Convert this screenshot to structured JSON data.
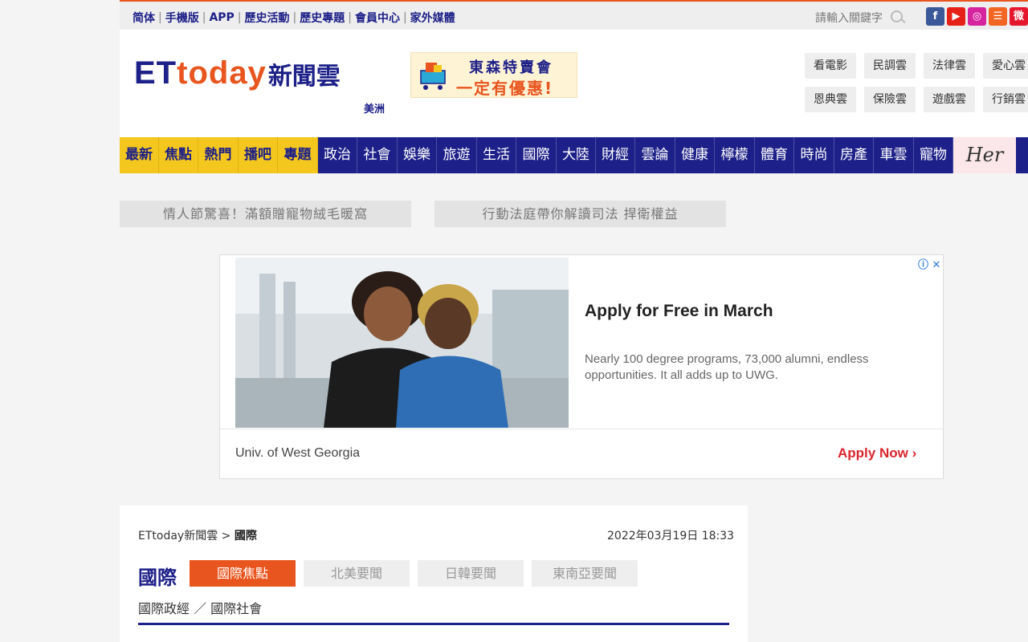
{
  "topbar": {
    "links": [
      "简体",
      "手機版",
      "APP",
      "歷史活動",
      "歷史專題",
      "會員中心",
      "家外媒體"
    ],
    "search_placeholder": "請輸入關鍵字",
    "social": [
      {
        "name": "facebook-icon",
        "glyph": "f",
        "color": "#3b5998"
      },
      {
        "name": "youtube-icon",
        "glyph": "▶",
        "color": "#e62117"
      },
      {
        "name": "instagram-icon",
        "glyph": "◎",
        "color": "#d6249f"
      },
      {
        "name": "rss-icon",
        "glyph": "☰",
        "color": "#f26522"
      },
      {
        "name": "weibo-icon",
        "glyph": "微",
        "color": "#e6162d"
      }
    ]
  },
  "header": {
    "logo_et": "ET",
    "logo_today": "today",
    "logo_cn": "新聞雲",
    "region": "美洲",
    "banner_line1": "東森特賣會",
    "banner_line2": "一定有優惠!",
    "cloud_links": [
      "看電影",
      "民調雲",
      "法律雲",
      "愛心雲",
      "恩典雲",
      "保險雲",
      "遊戲雲",
      "行銷雲"
    ]
  },
  "nav": {
    "hot_items": [
      "最新",
      "焦點",
      "熱門",
      "播吧",
      "專題"
    ],
    "items": [
      "政治",
      "社會",
      "娛樂",
      "旅遊",
      "生活",
      "國際",
      "大陸",
      "財經",
      "雲論",
      "健康",
      "檸檬",
      "體育",
      "時尚",
      "房產",
      "車雲",
      "寵物"
    ],
    "her": "Her"
  },
  "promos": [
    "情人節驚喜！滿額贈寵物絨毛暖窩",
    "行動法庭帶你解讀司法 捍衛權益"
  ],
  "ad": {
    "title": "Apply for Free in March",
    "description": "Nearly 100 degree programs, 73,000 alumni, endless opportunities. It all adds up to UWG.",
    "advertiser": "Univ. of West Georgia",
    "cta": "Apply Now",
    "cta_chevron": "›",
    "info_glyph": "ⓘ ✕"
  },
  "article": {
    "breadcrumb_home": "ETtoday新聞雲",
    "breadcrumb_sep": " > ",
    "breadcrumb_current": "國際",
    "date": "2022年03月19日 18:33",
    "section_title": "國際",
    "tabs": [
      "國際焦點",
      "北美要聞",
      "日韓要聞",
      "東南亞要聞"
    ],
    "subcategories": "國際政經 ／ 國際社會"
  }
}
